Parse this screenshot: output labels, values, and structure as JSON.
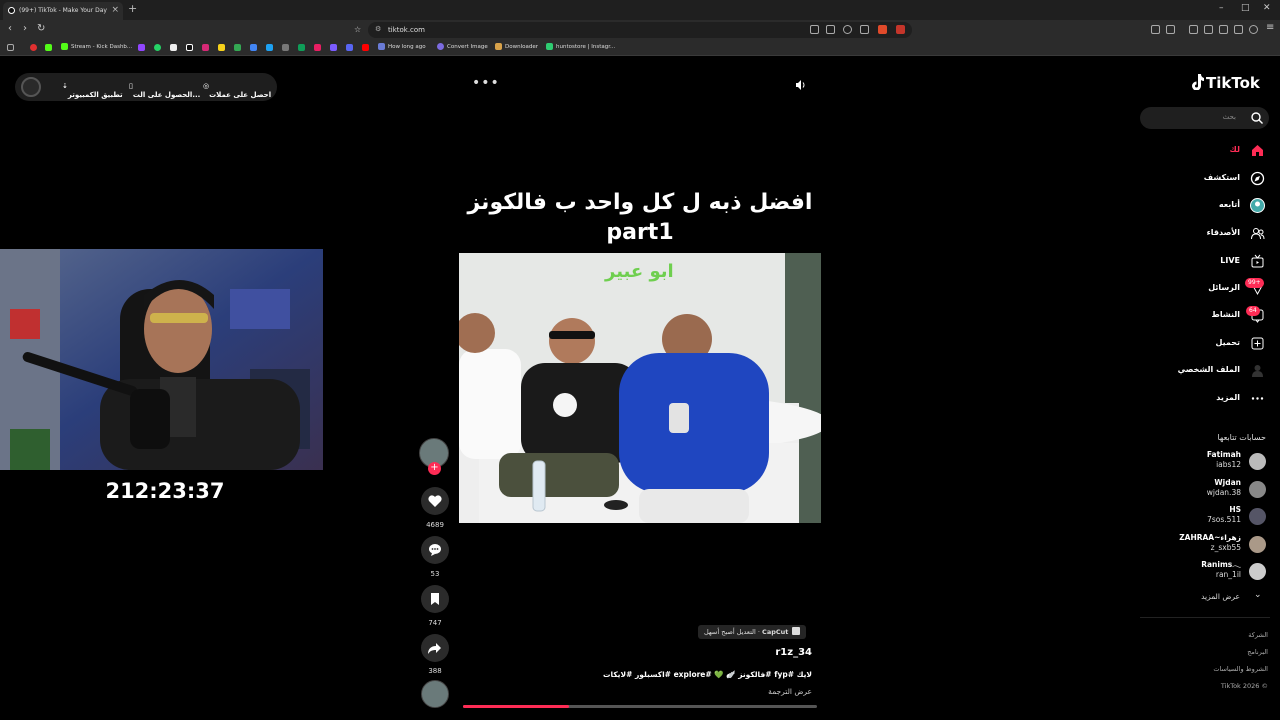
{
  "browser": {
    "tab_title": "(99+) TikTok - Make Your Day",
    "url": "tiktok.com",
    "bookmarks": [
      "Stream - Kick Dashb...",
      "How long ago",
      "Convert Image",
      "Downloader",
      "huntostore | Instagr..."
    ]
  },
  "topbar": {
    "coins_label": "احصل على عملات",
    "get_app_label": "الحصول على الت...",
    "desktop_app_label": "تطبيق الكمبيوتر"
  },
  "video": {
    "caption_line1": "افضل ذبه ل كل واحد ب فالكونز",
    "caption_line2": "part1",
    "overlay_text": "ابو عبير",
    "progress": 0.3
  },
  "webcam": {
    "timer": "212:23:37"
  },
  "actions": {
    "likes": "4689",
    "comments": "53",
    "saves": "747",
    "shares": "388"
  },
  "post": {
    "capcut_brand": "CapCut",
    "capcut_text": "التعديل أصبح أسهل ·",
    "username": "r1z_34",
    "description": "لايك #fyp #فالكونز 🪽 💚 #explore #اكسبلور #لايكات",
    "see_translation": "عرض الترجمة"
  },
  "sidebar": {
    "logo": "TikTok",
    "search_placeholder": "بحث",
    "nav": [
      {
        "label": "لك",
        "icon": "home-icon"
      },
      {
        "label": "استكشف",
        "icon": "compass-icon"
      },
      {
        "label": "أتابعه",
        "icon": "avatar-icon"
      },
      {
        "label": "الأصدقاء",
        "icon": "friends-icon"
      },
      {
        "label": "LIVE",
        "icon": "live-icon"
      },
      {
        "label": "الرسائل",
        "icon": "messages-icon",
        "badge": "99+"
      },
      {
        "label": "النشاط",
        "icon": "activity-icon",
        "badge": "64"
      },
      {
        "label": "تحميل",
        "icon": "upload-icon"
      },
      {
        "label": "الملف الشخصي",
        "icon": "profile-icon"
      },
      {
        "label": "المزيد",
        "icon": "more-icon"
      }
    ],
    "following_header": "حسابات تتابعها",
    "following": [
      {
        "name": "Fatimah",
        "user": "iabs12"
      },
      {
        "name": "Wjdan",
        "user": "wjdan.38"
      },
      {
        "name": "HS",
        "user": "7sos.511"
      },
      {
        "name": "ZAHRAA~زهراء",
        "user": "z_sxb55"
      },
      {
        "name": "Ranims𓂃",
        "user": "ran_1il"
      }
    ],
    "see_more": "عرض المزيد",
    "footer": [
      "الشركة",
      "البرنامج",
      "الشروط والسياسات",
      "TikTok 2026 ©"
    ]
  },
  "colors": {
    "accent": "#fe2c55"
  }
}
